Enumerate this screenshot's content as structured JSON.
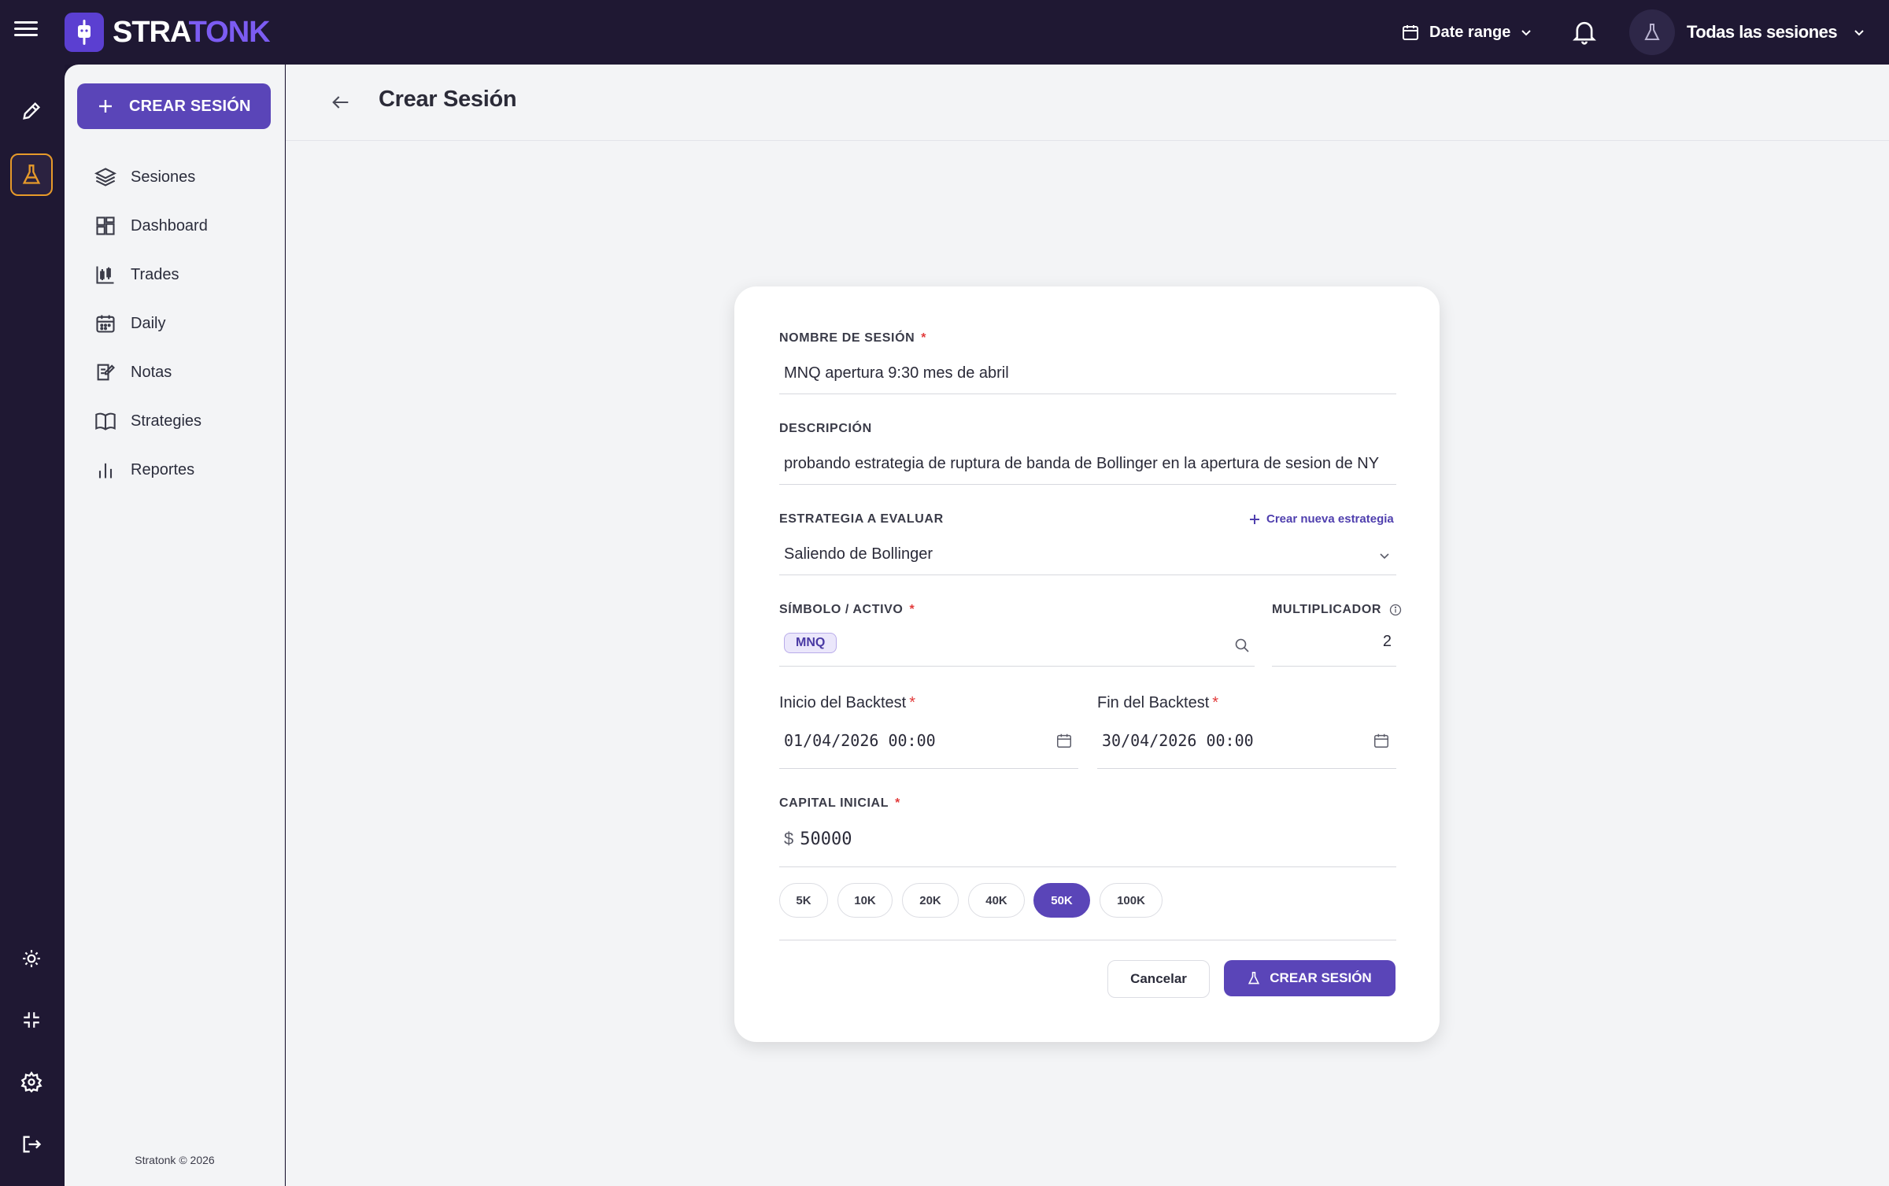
{
  "header": {
    "logo_text_a": "STRA",
    "logo_text_b": "TONK",
    "date_range": "Date range",
    "session_selector": "Todas las sesiones"
  },
  "sidebar": {
    "create_label": "CREAR SESIÓN",
    "items": [
      {
        "label": "Sesiones",
        "icon": "layers-icon"
      },
      {
        "label": "Dashboard",
        "icon": "dashboard-icon"
      },
      {
        "label": "Trades",
        "icon": "candlestick-icon"
      },
      {
        "label": "Daily",
        "icon": "calendar-icon"
      },
      {
        "label": "Notas",
        "icon": "notes-icon"
      },
      {
        "label": "Strategies",
        "icon": "book-icon"
      },
      {
        "label": "Reportes",
        "icon": "bar-chart-icon"
      }
    ],
    "footer": "Stratonk © 2026"
  },
  "page": {
    "title": "Crear Sesión"
  },
  "form": {
    "name_label": "NOMBRE DE SESIÓN",
    "name_value": "MNQ apertura 9:30 mes de abril",
    "description_label": "DESCRIPCIÓN",
    "description_value": "probando estrategia de ruptura de banda de Bollinger en la apertura de sesion de NY",
    "strategy_label": "ESTRATEGIA A EVALUAR",
    "new_strategy_link": "Crear nueva estrategia",
    "strategy_value": "Saliendo de Bollinger",
    "symbol_label": "SÍMBOLO / ACTIVO",
    "symbol_tag": "MNQ",
    "multiplier_label": "MULTIPLICADOR",
    "multiplier_value": "2",
    "start_label": "Inicio del Backtest",
    "start_value": "01/04/2026 00:00",
    "end_label": "Fin del Backtest",
    "end_value": "30/04/2026 00:00",
    "capital_label": "CAPITAL INICIAL",
    "currency": "$",
    "capital_value": "50000",
    "presets": [
      "5K",
      "10K",
      "20K",
      "40K",
      "50K",
      "100K"
    ],
    "selected_preset": "50K",
    "required_mark": "*",
    "cancel_label": "Cancelar",
    "submit_label": "CREAR SESIÓN"
  },
  "colors": {
    "brand": "#5a45b8",
    "topbar": "#1f1833",
    "active_rail": "#e79a2a",
    "required": "#e23b3b"
  }
}
